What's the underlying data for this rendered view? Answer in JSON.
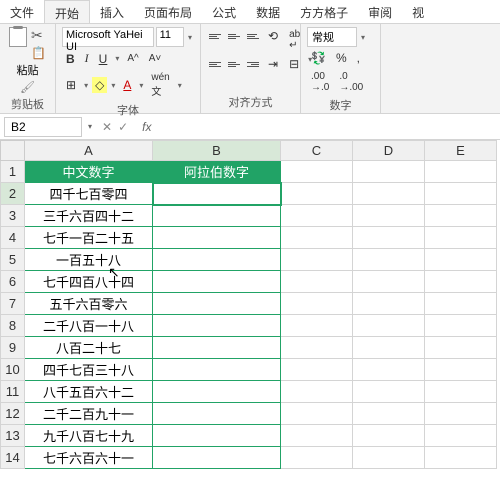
{
  "tabs": [
    "文件",
    "开始",
    "插入",
    "页面布局",
    "公式",
    "数据",
    "方方格子",
    "审阅",
    "视"
  ],
  "activeTab": 1,
  "ribbon": {
    "clipboard": {
      "paste": "粘贴",
      "label": "剪贴板"
    },
    "font": {
      "name": "Microsoft YaHei UI",
      "size": "11",
      "label": "字体"
    },
    "align": {
      "label": "对齐方式"
    },
    "number": {
      "format": "常规",
      "label": "数字"
    }
  },
  "namebox": "B2",
  "cols": [
    "A",
    "B",
    "C",
    "D",
    "E"
  ],
  "headers": {
    "A": "中文数字",
    "B": "阿拉伯数字"
  },
  "rows": [
    {
      "n": 1,
      "A": "",
      "B": ""
    },
    {
      "n": 2,
      "A": "四千七百零四",
      "B": ""
    },
    {
      "n": 3,
      "A": "三千六百四十二",
      "B": ""
    },
    {
      "n": 4,
      "A": "七千一百二十五",
      "B": ""
    },
    {
      "n": 5,
      "A": "一百五十八",
      "B": ""
    },
    {
      "n": 6,
      "A": "七千四百八十四",
      "B": ""
    },
    {
      "n": 7,
      "A": "五千六百零六",
      "B": ""
    },
    {
      "n": 8,
      "A": "二千八百一十八",
      "B": ""
    },
    {
      "n": 9,
      "A": "八百二十七",
      "B": ""
    },
    {
      "n": 10,
      "A": "四千七百三十八",
      "B": ""
    },
    {
      "n": 11,
      "A": "八千五百六十二",
      "B": ""
    },
    {
      "n": 12,
      "A": "二千二百九十一",
      "B": ""
    },
    {
      "n": 13,
      "A": "九千八百七十九",
      "B": ""
    },
    {
      "n": 14,
      "A": "七千六百六十一",
      "B": ""
    }
  ]
}
